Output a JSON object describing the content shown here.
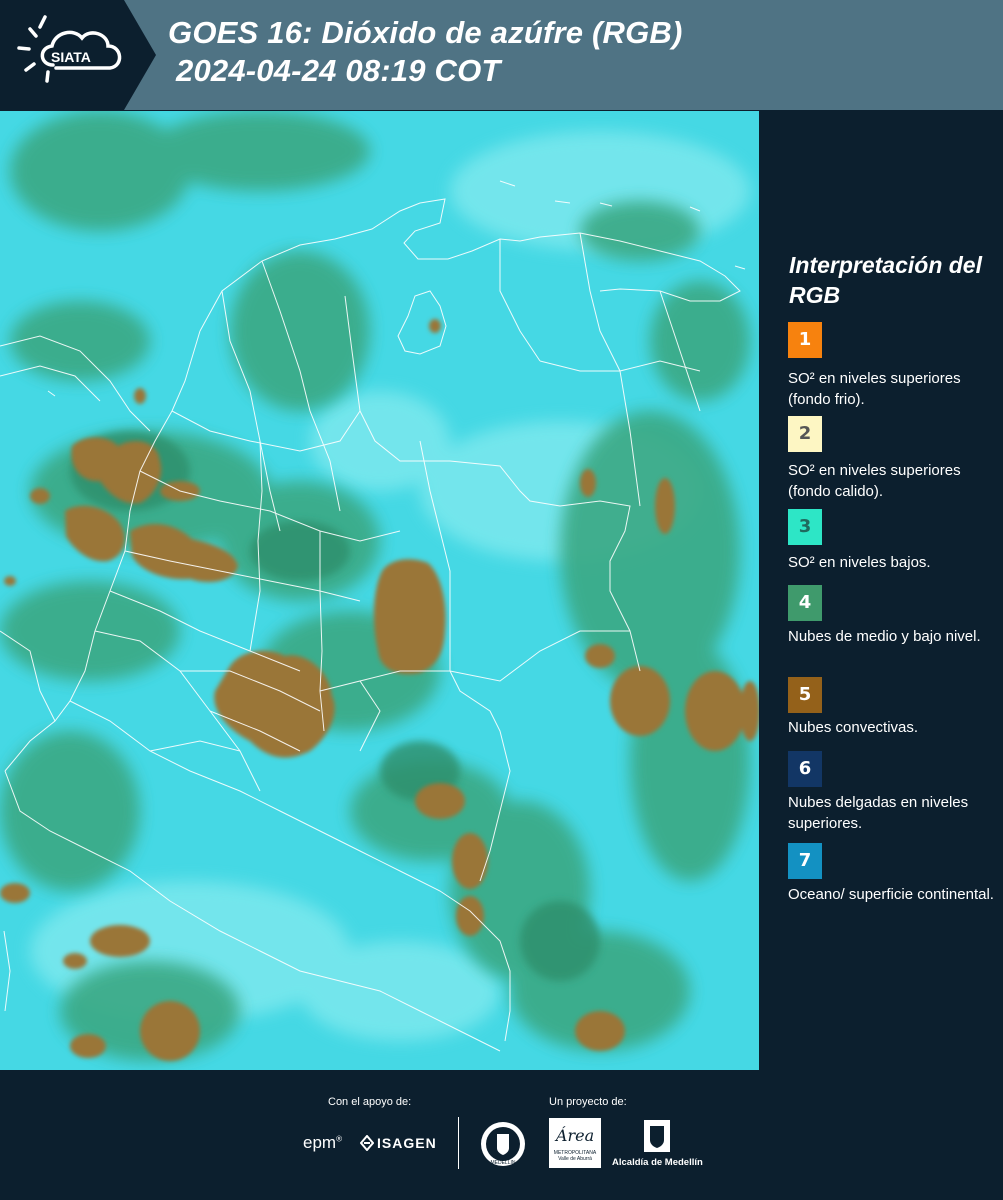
{
  "header": {
    "logo_text": "SIATA",
    "title_line1": "GOES 16: Dióxido de azúfre (RGB)",
    "title_line2": "2024-04-24 08:19 COT",
    "background_color": "#4f7384"
  },
  "map": {
    "product": "GOES 16 SO2 RGB",
    "colors": {
      "background": "#45d8e4",
      "green_clouds": "#3fae86",
      "convective": "#9a7638",
      "borders": "#ffffff"
    }
  },
  "legend": {
    "title": "Interpretación del RGB",
    "items": [
      {
        "number": "1",
        "color": "#f7820e",
        "text_color": "#ffffff",
        "label": "SO² en niveles superiores (fondo frio)."
      },
      {
        "number": "2",
        "color": "#fdf6c3",
        "text_color": "#555555",
        "label": "SO² en niveles superiores (fondo calido)."
      },
      {
        "number": "3",
        "color": "#2de6c6",
        "text_color": "#1f6a5e",
        "label": "SO² en niveles bajos."
      },
      {
        "number": "4",
        "color": "#3f9a6c",
        "text_color": "#ffffff",
        "label": "Nubes de medio y bajo nivel."
      },
      {
        "number": "5",
        "color": "#94611a",
        "text_color": "#ffffff",
        "label": "Nubes convectivas."
      },
      {
        "number": "6",
        "color": "#123665",
        "text_color": "#ffffff",
        "label": "Nubes delgadas en niveles superiores."
      },
      {
        "number": "7",
        "color": "#1391c2",
        "text_color": "#ffffff",
        "label": "Oceano/ superficie continental."
      }
    ]
  },
  "footer": {
    "support_label": "Con el apoyo de:",
    "project_label": "Un proyecto de:",
    "sponsors": [
      "epm",
      "ISAGEN"
    ],
    "partners": [
      "MEDELLIN",
      "Área METROPOLITANA Valle de Aburrá",
      "Alcaldía de Medellín"
    ]
  }
}
